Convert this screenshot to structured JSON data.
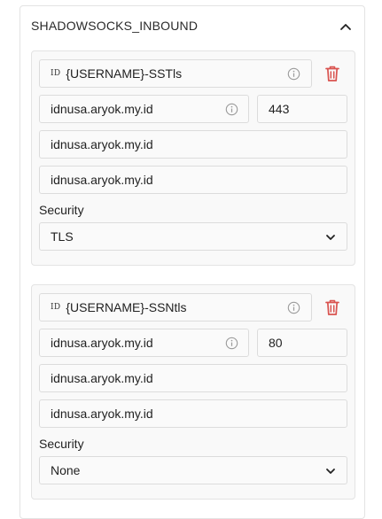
{
  "panel": {
    "title": "SHADOWSOCKS_INBOUND"
  },
  "inbounds": [
    {
      "id_prefix": "ID",
      "name": "{USERNAME}-SSTls",
      "server": "idnusa.aryok.my.id",
      "port": "443",
      "host": "idnusa.aryok.my.id",
      "sni": "idnusa.aryok.my.id",
      "security_label": "Security",
      "security_value": "TLS"
    },
    {
      "id_prefix": "ID",
      "name": "{USERNAME}-SSNtls",
      "server": "idnusa.aryok.my.id",
      "port": "80",
      "host": "idnusa.aryok.my.id",
      "sni": "idnusa.aryok.my.id",
      "security_label": "Security",
      "security_value": "None"
    }
  ],
  "colors": {
    "delete": "#d9534f",
    "border": "#dcdcdc"
  },
  "icons": {
    "collapse": "chevron-up-icon",
    "info": "info-icon",
    "delete": "trash-icon",
    "dropdown": "chevron-down-icon"
  }
}
